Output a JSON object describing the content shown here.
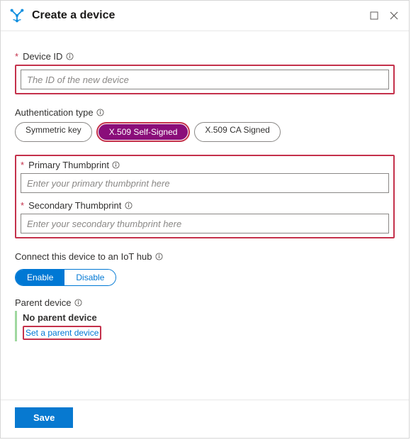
{
  "header": {
    "title": "Create a device"
  },
  "deviceId": {
    "label": "Device ID",
    "placeholder": "The ID of the new device"
  },
  "authType": {
    "label": "Authentication type",
    "options": {
      "symmetric": "Symmetric key",
      "x509self": "X.509 Self-Signed",
      "x509ca": "X.509 CA Signed"
    }
  },
  "thumbprints": {
    "primaryLabel": "Primary Thumbprint",
    "primaryPlaceholder": "Enter your primary thumbprint here",
    "secondaryLabel": "Secondary Thumbprint",
    "secondaryPlaceholder": "Enter your secondary thumbprint here"
  },
  "iotHub": {
    "label": "Connect this device to an IoT hub",
    "enable": "Enable",
    "disable": "Disable"
  },
  "parent": {
    "label": "Parent device",
    "current": "No parent device",
    "set": "Set a parent device"
  },
  "footer": {
    "save": "Save"
  }
}
